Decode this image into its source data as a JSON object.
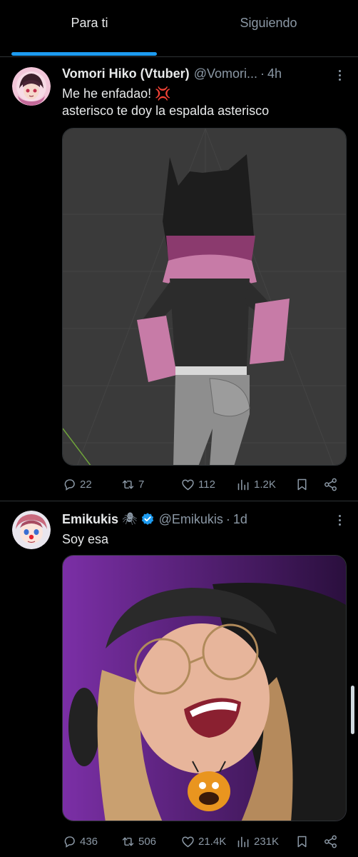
{
  "tabs": {
    "for_you": "Para ti",
    "following": "Siguiendo"
  },
  "tweets": [
    {
      "name": "Vomori Hiko (Vtuber)",
      "handle": "@Vomori...",
      "dot": "·",
      "time": "4h",
      "line1": "Me he enfadao! 💢",
      "line2": "asterisco te doy la espalda asterisco",
      "replies": "22",
      "retweets": "7",
      "likes": "112",
      "views": "1.2K"
    },
    {
      "name": "Emikukis",
      "name_emoji": "🕷",
      "handle": "@Emikukis",
      "dot": "·",
      "time": "1d",
      "line1": "Soy esa",
      "replies": "436",
      "retweets": "506",
      "likes": "21.4K",
      "views": "231K"
    }
  ],
  "colors": {
    "accent": "#1d9bf0",
    "muted": "#8b98a5",
    "verified": "#1d9bf0"
  }
}
